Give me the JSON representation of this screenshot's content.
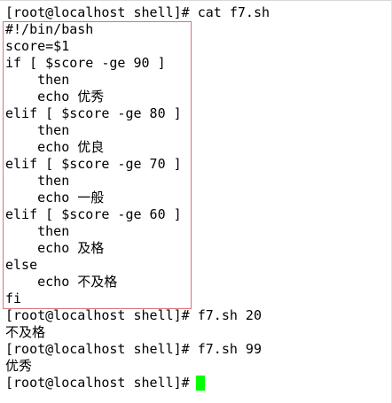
{
  "terminal": {
    "lines": [
      "[root@localhost shell]# cat f7.sh",
      "#!/bin/bash",
      "score=$1",
      "if [ $score -ge 90 ]",
      "    then",
      "    echo 优秀",
      "elif [ $score -ge 80 ]",
      "    then",
      "    echo 优良",
      "elif [ $score -ge 70 ]",
      "    then",
      "    echo 一般",
      "elif [ $score -ge 60 ]",
      "    then",
      "    echo 及格",
      "else",
      "    echo 不及格",
      "fi",
      "[root@localhost shell]# f7.sh 20",
      "不及格",
      "[root@localhost shell]# f7.sh 99",
      "优秀",
      "[root@localhost shell]# "
    ],
    "highlight_color": "#d9737a",
    "cursor_color": "#00ff00",
    "background_color": "#ffffff",
    "text_color": "#000000"
  }
}
